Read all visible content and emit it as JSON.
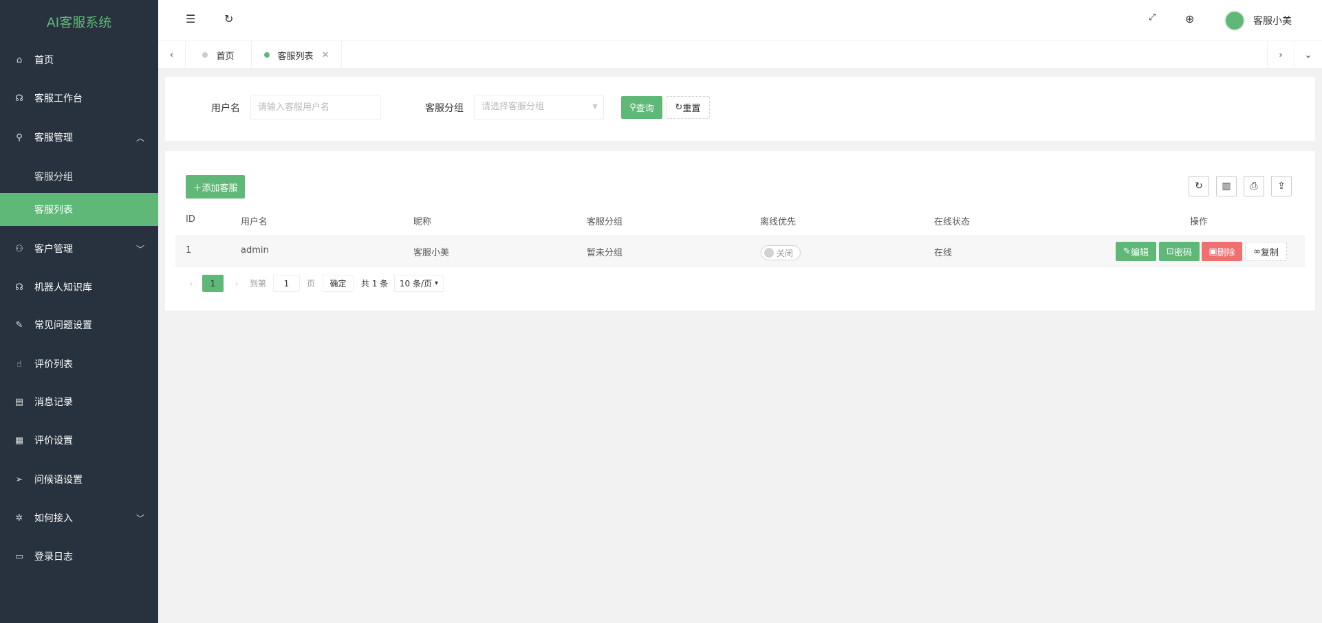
{
  "app": {
    "title": "AI客服系统"
  },
  "sidebar": {
    "items": [
      {
        "label": "首页",
        "icon": "home-icon"
      },
      {
        "label": "客服工作台",
        "icon": "headset-icon"
      },
      {
        "label": "客服管理",
        "icon": "user-icon",
        "expanded": true
      },
      {
        "label": "客服分组"
      },
      {
        "label": "客服列表",
        "active": true
      },
      {
        "label": "客户管理",
        "icon": "users-icon"
      },
      {
        "label": "机器人知识库",
        "icon": "robot-icon"
      },
      {
        "label": "常见问题设置",
        "icon": "faq-icon"
      },
      {
        "label": "评价列表",
        "icon": "thumb-up-icon"
      },
      {
        "label": "消息记录",
        "icon": "message-icon"
      },
      {
        "label": "评价设置",
        "icon": "calendar-icon"
      },
      {
        "label": "问候语设置",
        "icon": "send-icon"
      },
      {
        "label": "如何接入",
        "icon": "plug-icon"
      },
      {
        "label": "登录日志",
        "icon": "log-icon"
      }
    ]
  },
  "header": {
    "user_name": "客服小美"
  },
  "tabs": [
    {
      "label": "首页"
    },
    {
      "label": "客服列表",
      "active": true
    }
  ],
  "search": {
    "username_label": "用户名",
    "username_placeholder": "请输入客服用户名",
    "group_label": "客服分组",
    "group_placeholder": "请选择客服分组",
    "query_label": "查询",
    "reset_label": "重置"
  },
  "table": {
    "add_label": "添加客服",
    "columns": [
      "ID",
      "用户名",
      "昵称",
      "客服分组",
      "离线优先",
      "在线状态",
      "操作"
    ],
    "rows": [
      {
        "id": "1",
        "username": "admin",
        "nickname": "客服小美",
        "group": "暂未分组",
        "offline_first": "关闭",
        "online_status": "在线"
      }
    ],
    "actions": {
      "edit": "编辑",
      "password": "密码",
      "delete": "删除",
      "copy": "复制"
    }
  },
  "pagination": {
    "current": "1",
    "goto_label": "到第",
    "goto_value": "1",
    "page_label": "页",
    "confirm_label": "确定",
    "total": "共 1 条",
    "page_size": "10 条/页"
  },
  "colors": {
    "accent": "#5fb878",
    "danger": "#f07070",
    "sidebar": "#28323e"
  }
}
